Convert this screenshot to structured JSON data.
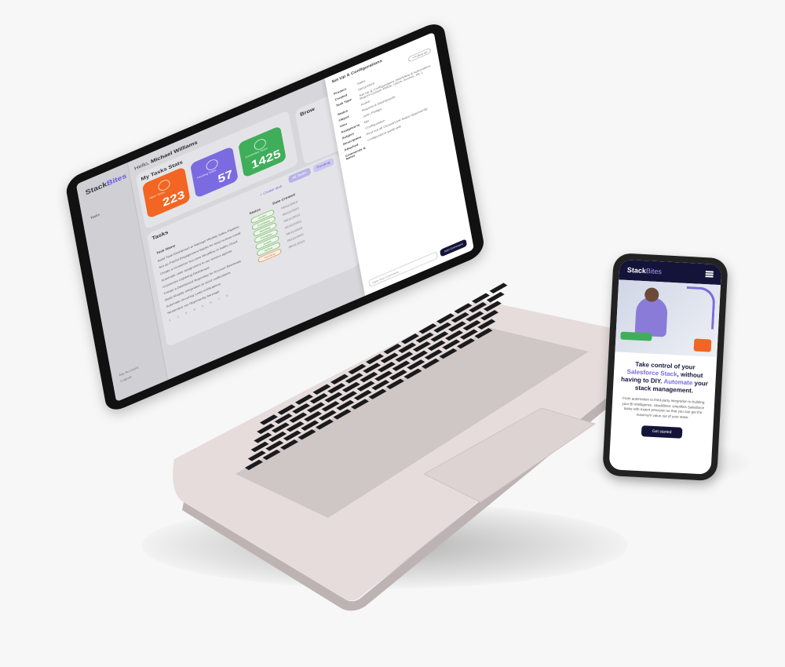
{
  "laptop": {
    "logo": {
      "stack": "Stack",
      "bites": "Bites"
    },
    "nav": {
      "item": "Tasks"
    },
    "sidebar_footer": {
      "account": "My Account",
      "logout": "Logout"
    },
    "greeting": {
      "hello": "Hello,",
      "name": "Michael Williams"
    },
    "stats_title": "My Tasks Stats",
    "stats": [
      {
        "label": "Open Tasks",
        "value": "223",
        "color": "#f26522"
      },
      {
        "label": "Pending Tasks",
        "value": "57",
        "color": "#7b6be0"
      },
      {
        "label": "Completed Tasks",
        "value": "1425",
        "color": "#3fae5a"
      }
    ],
    "browse": {
      "title": "Brow",
      "rows": [
        "",
        "",
        ""
      ]
    },
    "tasks": {
      "title": "Tasks",
      "add_link": "+ Create task",
      "tabs": [
        "All Tasks",
        "Pending"
      ],
      "columns": [
        "Task Name",
        "Status",
        "Date Created"
      ],
      "rows": [
        {
          "name": "Build Task Dashboard to Manage Weekly Sales Pipeline",
          "status": "Active",
          "date": "06/11/2023",
          "tone": "green"
        },
        {
          "name": "Set up Pardot Engagement Studio for lead nurture email",
          "status": "Complete",
          "date": "06/11/2023",
          "tone": "green"
        },
        {
          "name": "Create a Customer Success Workflow in Sales Cloud",
          "status": "Pending",
          "date": "06/11/2023",
          "tone": "green"
        },
        {
          "name": "Automate case assignment to my service agents",
          "status": "Pending",
          "date": "06/11/2023",
          "tone": "green"
        },
        {
          "name": "Customize Lightning Dashboard",
          "status": "Active",
          "date": "06/11/2023",
          "tone": "green"
        },
        {
          "name": "Create a Dashboard Reporting for Account Renewals",
          "status": "Active",
          "date": "06/11/2023",
          "tone": "green"
        },
        {
          "name": "Build Shopify Integration to send notifications",
          "status": "Pending",
          "date": "06/11/2023",
          "tone": "orange"
        },
        {
          "name": "Automate recurring Lead notifications",
          "status": "",
          "date": "",
          "tone": "green"
        },
        {
          "name": "Streamline my Opportunity list page",
          "status": "",
          "date": "",
          "tone": "green"
        }
      ],
      "pager": "1 2 3 4 5 6 7 8"
    },
    "panel": {
      "title": "Set Up & Configurations",
      "button": "+ Follow up",
      "fields": [
        {
          "key": "Product",
          "value": "Sales"
        },
        {
          "key": "Created",
          "value": "06/11/2023"
        },
        {
          "key": "Task Type",
          "value": "Set Up & Configurations (Workflow & Automation, Report Custom Fields, Users, Access, etc.)"
        },
        {
          "key": "Status",
          "value": "Active"
        },
        {
          "key": "Object",
          "value": "Reports & Dashboards"
        },
        {
          "key": "User",
          "value": "John Phillips"
        },
        {
          "key": "Assigned to",
          "value": "Me"
        },
        {
          "key": "Subject",
          "value": "Configuration"
        },
        {
          "key": "Description",
          "value": "Find out all Closed/Lost Sales Opportunity"
        },
        {
          "key": "Attached",
          "value": "configuration-guide.pdf"
        },
        {
          "key": "Comments & Notes",
          "value": ""
        }
      ],
      "comment_placeholder": "Type Your Comment...",
      "send": "Add Comment"
    }
  },
  "phone": {
    "logo": {
      "stack": "Stack",
      "bites": "Bites"
    },
    "headline": {
      "a": "Take control of your ",
      "b": "Salesforce Stack",
      "c": ", without having to DIY. ",
      "d": "Automate",
      "e": " your stack management."
    },
    "body": "From automation to third-party integration to building your BI intelligence, StackBites' simplifies Salesforce tasks with expert precision so that you can get the maximum value out of your stack.",
    "cta": "Get started"
  }
}
